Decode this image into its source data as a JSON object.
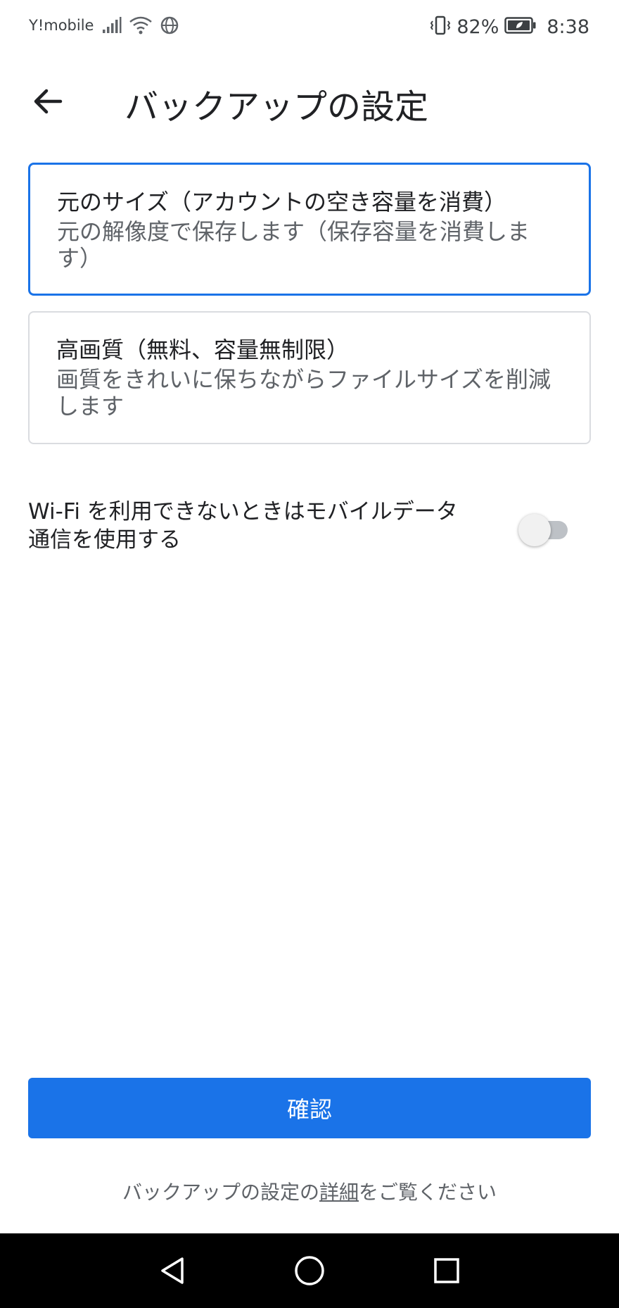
{
  "status_bar": {
    "carrier": "Y!mobile",
    "battery_percent": "82%",
    "time": "8:38",
    "icons": [
      "signal-icon",
      "wifi-icon",
      "vpn-globe-icon",
      "vibrate-icon",
      "battery-icon"
    ]
  },
  "app_bar": {
    "back_icon": "arrow-left-icon",
    "title": "バックアップの設定"
  },
  "options": [
    {
      "title": "元のサイズ（アカウントの空き容量を消費）",
      "description": "元の解像度で保存します（保存容量を消費します）",
      "selected": true
    },
    {
      "title": "高画質（無料、容量無制限）",
      "description": "画質をきれいに保ちながらファイルサイズを削減します",
      "selected": false
    }
  ],
  "mobile_data": {
    "label": "Wi-Fi を利用できないときはモバイルデータ通信を使用する",
    "enabled": false
  },
  "confirm_button": {
    "label": "確認"
  },
  "footer": {
    "prefix": "バックアップの設定の",
    "link": "詳細",
    "suffix": "をご覧ください"
  },
  "colors": {
    "accent": "#1a73e8",
    "selected_border": "#1a73e8",
    "unselected_border": "#dadce0",
    "nav_bar": "#000000"
  },
  "nav_bar": {
    "icons": [
      "back-triangle-icon",
      "home-circle-icon",
      "recents-square-icon"
    ]
  }
}
